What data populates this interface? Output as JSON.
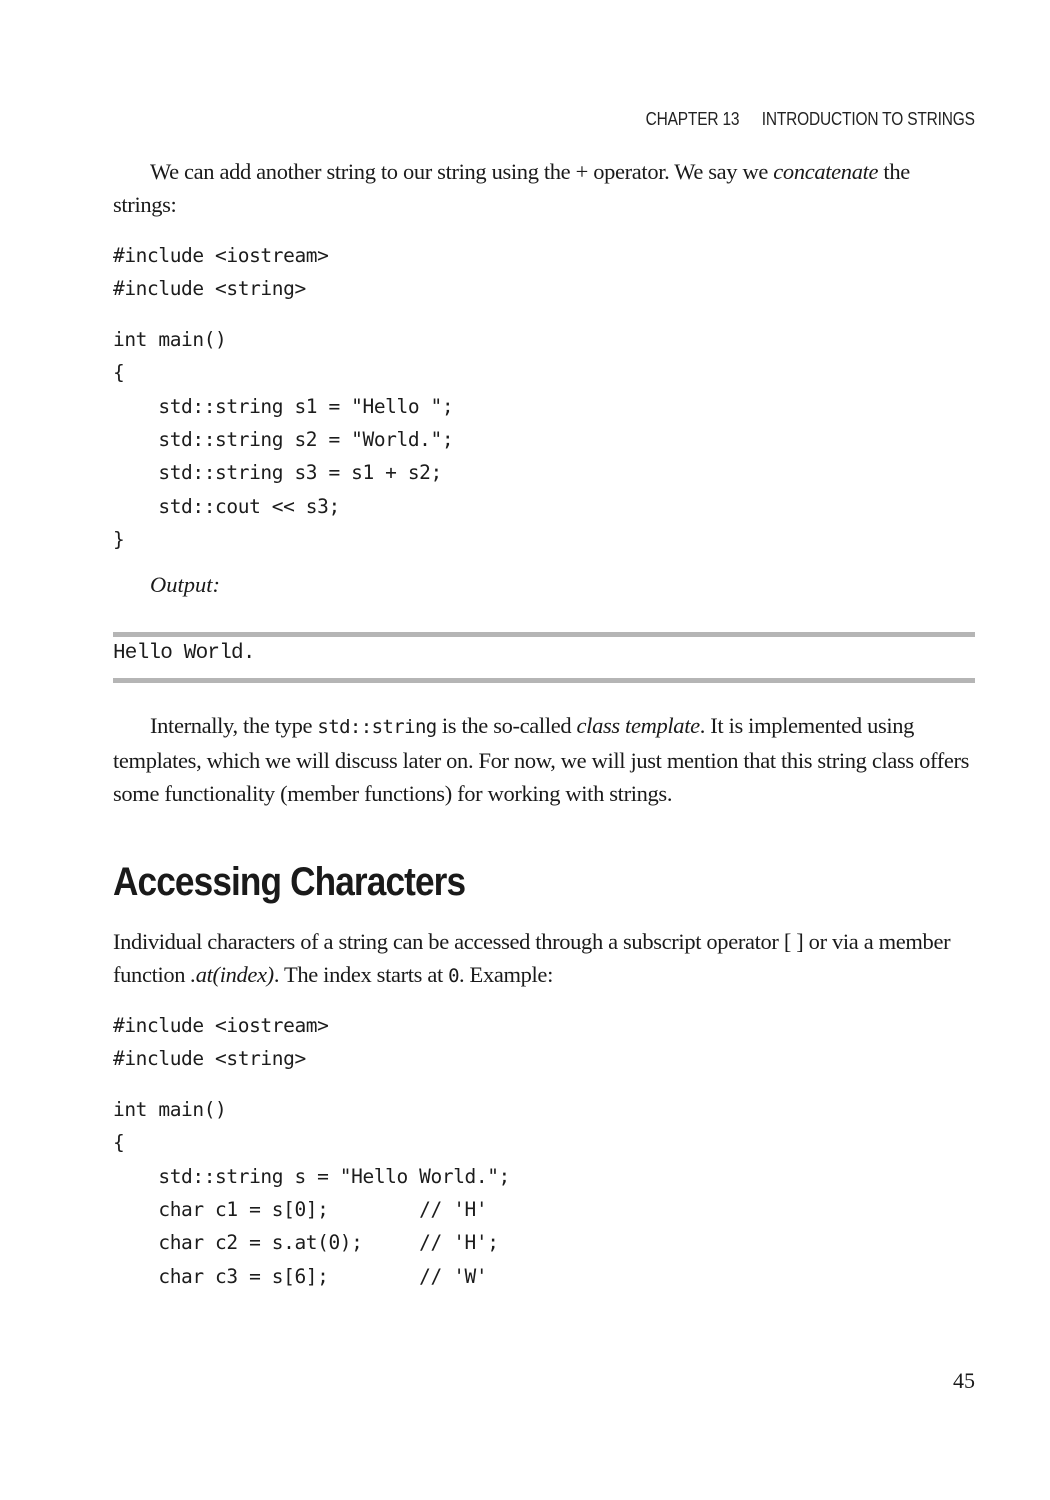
{
  "header": {
    "chapter": "CHAPTER 13",
    "chapter_title": "INTRODUCTION TO STRINGS"
  },
  "intro_paragraph": {
    "text_before": "We can add another string to our string using the + operator. We say we ",
    "emphasis": "concatenate",
    "text_after": " the strings:"
  },
  "code_block_1": {
    "includes": [
      "#include <iostream>",
      "#include <string>"
    ],
    "body": [
      "int main()",
      "{",
      "    std::string s1 = \"Hello \";",
      "    std::string s2 = \"World.\";",
      "    std::string s3 = s1 + s2;",
      "    std::cout << s3;",
      "}"
    ]
  },
  "output": {
    "label": "Output:",
    "text": "Hello World."
  },
  "explanation_paragraph": {
    "text_before": "Internally, the type ",
    "code": "std::string",
    "text_middle": " is the so-called ",
    "emphasis": "class template",
    "text_after": ". It is implemented using templates, which we will discuss later on. For now, we will just mention that this string class offers some functionality (member functions) for working with strings."
  },
  "section": {
    "title": "Accessing Characters"
  },
  "access_paragraph": {
    "text_before": "Individual characters of a string can be accessed through a subscript operator [ ] or via a member function ",
    "emphasis": ".at(index)",
    "text_middle": ". The index starts at ",
    "code": "0",
    "text_after": ". Example:"
  },
  "code_block_2": {
    "includes": [
      "#include <iostream>",
      "#include <string>"
    ],
    "body": [
      "int main()",
      "{",
      "    std::string s = \"Hello World.\";",
      "    char c1 = s[0];        // 'H'",
      "    char c2 = s.at(0);     // 'H';",
      "    char c3 = s[6];        // 'W'"
    ]
  },
  "footer": {
    "page_number": "45"
  }
}
